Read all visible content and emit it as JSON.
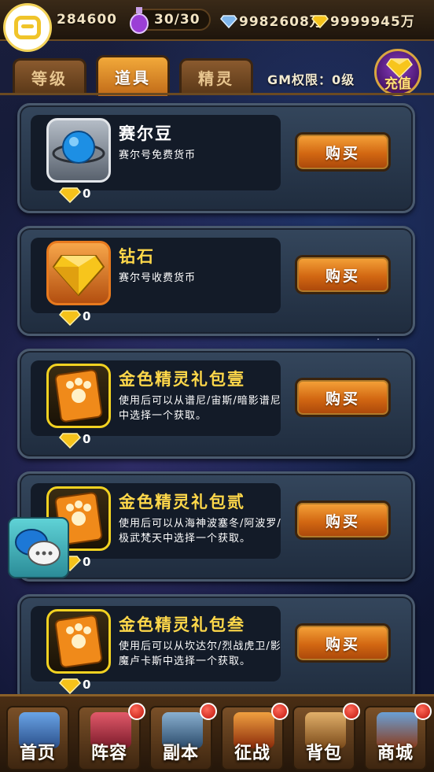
{
  "topbar": {
    "gold": "284600",
    "energy": "30/30",
    "silver_currency": "9982608万",
    "diamond_currency": "9999945万"
  },
  "tabs": [
    {
      "label": "等级",
      "active": false
    },
    {
      "label": "道具",
      "active": true
    },
    {
      "label": "精灵",
      "active": false
    }
  ],
  "gm_label": "GM权限：0级",
  "recharge_label": "充值",
  "items": [
    {
      "name": "赛尔豆",
      "desc": "赛尔号免费货币",
      "price": "0",
      "buy_label": "购买",
      "icon": "seer-bean-icon"
    },
    {
      "name": "钻石",
      "desc": "赛尔号收费货币",
      "price": "0",
      "buy_label": "购买",
      "icon": "diamond-icon"
    },
    {
      "name": "金色精灵礼包壹",
      "desc": "使用后可以从谱尼/宙斯/暗影谱尼中选择一个获取。",
      "price": "0",
      "buy_label": "购买",
      "icon": "gold-pack-icon"
    },
    {
      "name": "金色精灵礼包贰",
      "desc": "使用后可以从海神波塞冬/阿波罗/极武梵天中选择一个获取。",
      "price": "0",
      "buy_label": "购买",
      "icon": "gold-pack-icon"
    },
    {
      "name": "金色精灵礼包叁",
      "desc": "使用后可以从坎达尔/烈战虎卫/影魔卢卡斯中选择一个获取。",
      "price": "0",
      "buy_label": "购买",
      "icon": "gold-pack-icon"
    }
  ],
  "nav": [
    {
      "label": "首页",
      "badge": false,
      "color": "#3a6fb0"
    },
    {
      "label": "阵容",
      "badge": true,
      "color": "#b03a4a"
    },
    {
      "label": "副本",
      "badge": true,
      "color": "#4a6a8a"
    },
    {
      "label": "征战",
      "badge": true,
      "color": "#b04a1a"
    },
    {
      "label": "背包",
      "badge": true,
      "color": "#a0702a"
    },
    {
      "label": "商城",
      "badge": true,
      "color": "#8a4a2a"
    }
  ],
  "colors": {
    "gold_text": "#ffd84a",
    "buy_button": "#d26712",
    "badge_red": "#c0160c",
    "tab_active": "#f2a93a"
  }
}
